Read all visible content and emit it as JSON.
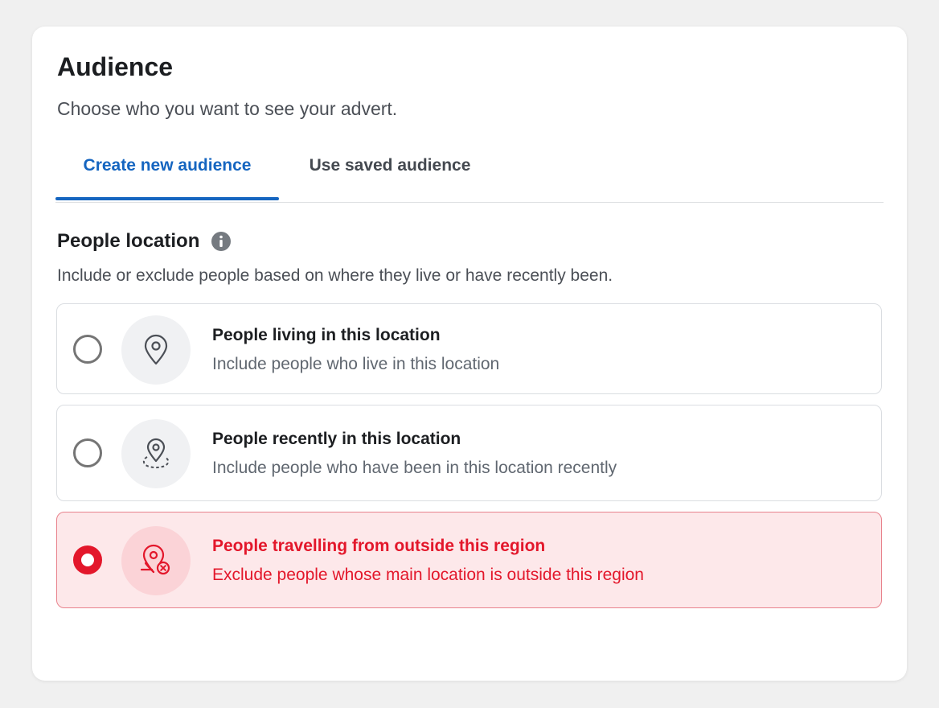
{
  "header": {
    "title": "Audience",
    "subtitle": "Choose who you want to see your advert."
  },
  "tabs": [
    {
      "label": "Create new audience",
      "active": true
    },
    {
      "label": "Use saved audience",
      "active": false
    }
  ],
  "location_section": {
    "title": "People location",
    "info_icon": "info-icon",
    "description": "Include or exclude people based on where they live or have recently been.",
    "options": [
      {
        "title": "People living in this location",
        "description": "Include people who live in this location",
        "icon": "map-pin-icon",
        "selected": false
      },
      {
        "title": "People recently in this location",
        "description": "Include people who have been in this location recently",
        "icon": "map-pin-dashed-icon",
        "selected": false
      },
      {
        "title": "People travelling from outside this region",
        "description": "Exclude people whose main location is outside this region",
        "icon": "map-pin-exclude-icon",
        "selected": true
      }
    ]
  },
  "colors": {
    "accent_blue": "#1565c0",
    "selected_red": "#e3172b",
    "selected_bg": "#fde8ea"
  }
}
